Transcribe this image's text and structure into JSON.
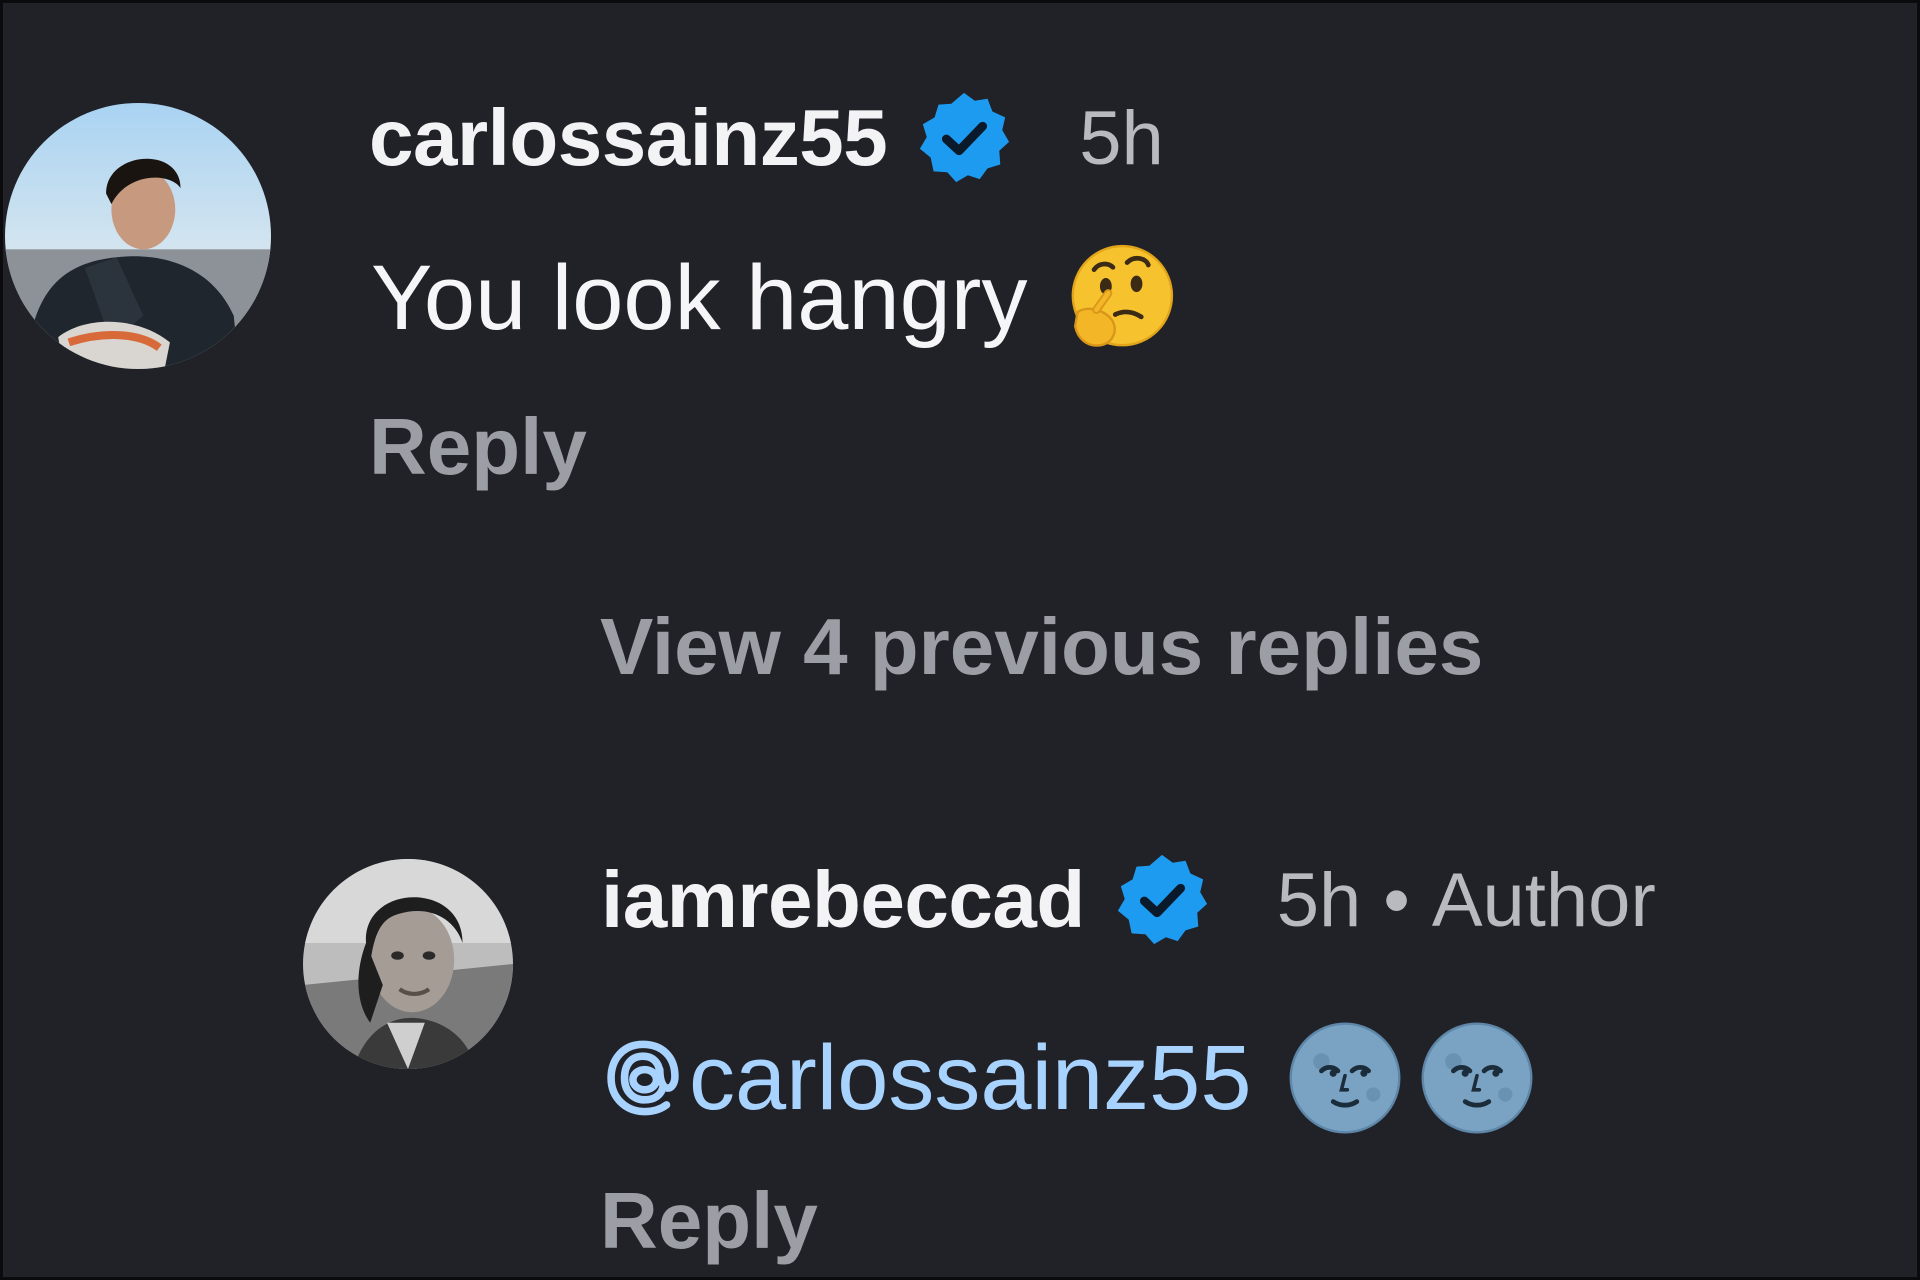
{
  "colors": {
    "background": "#212228",
    "username": "#f3f3f5",
    "muted": "#b9bac0",
    "reply": "#9c9ea5",
    "mention": "#a8d3ff",
    "verified_badge": "#1d9bf0"
  },
  "comments": [
    {
      "username": "carlossainz55",
      "verified": true,
      "time": "5h",
      "text": "You look hangry",
      "emojis": [
        "thinking-face"
      ],
      "reply_label": "Reply",
      "avatar_icon": "profile-photo-icon"
    },
    {
      "username": "iamrebeccad",
      "verified": true,
      "time": "5h",
      "separator": "•",
      "role_label": "Author",
      "mention": "carlossainz55",
      "emojis": [
        "full-moon-face",
        "full-moon-face"
      ],
      "reply_label": "Reply",
      "avatar_icon": "profile-photo-icon"
    }
  ],
  "thread": {
    "view_previous_label": "View 4 previous replies"
  }
}
